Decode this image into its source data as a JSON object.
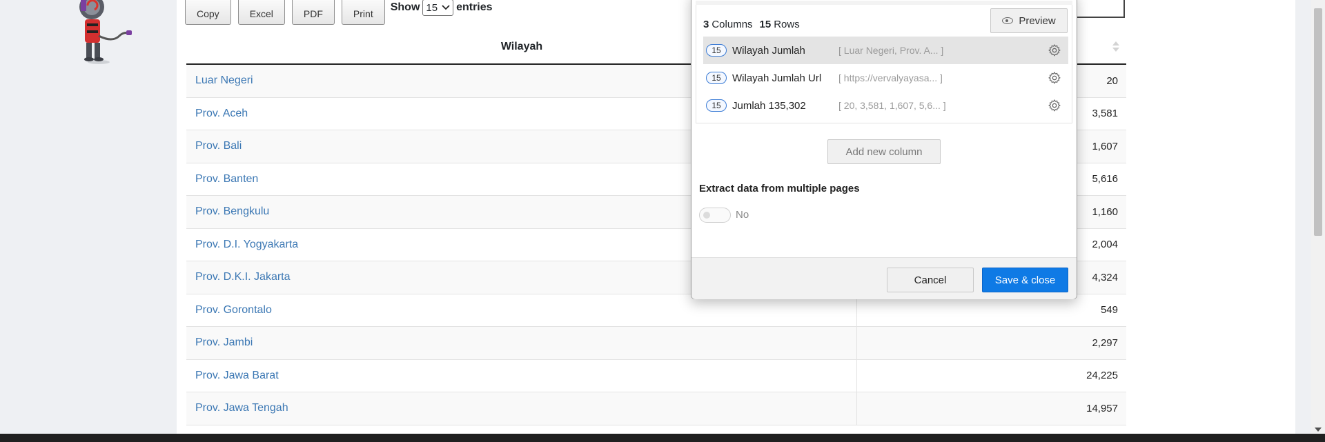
{
  "toolbar": {
    "buttons": [
      "Copy",
      "Excel",
      "PDF",
      "Print"
    ],
    "show_label": "Show",
    "entries_value": "15",
    "entries_label": "entries"
  },
  "table": {
    "header_name": "Wilayah",
    "rows": [
      {
        "name": "Luar Negeri",
        "value": "20"
      },
      {
        "name": "Prov. Aceh",
        "value": "3,581"
      },
      {
        "name": "Prov. Bali",
        "value": "1,607"
      },
      {
        "name": "Prov. Banten",
        "value": "5,616"
      },
      {
        "name": "Prov. Bengkulu",
        "value": "1,160"
      },
      {
        "name": "Prov. D.I. Yogyakarta",
        "value": "2,004"
      },
      {
        "name": "Prov. D.K.I. Jakarta",
        "value": "4,324"
      },
      {
        "name": "Prov. Gorontalo",
        "value": "549"
      },
      {
        "name": "Prov. Jambi",
        "value": "2,297"
      },
      {
        "name": "Prov. Jawa Barat",
        "value": "24,225"
      },
      {
        "name": "Prov. Jawa Tengah",
        "value": "14,957"
      }
    ]
  },
  "dialog": {
    "columns_count": "3",
    "columns_label": "Columns",
    "rows_count": "15",
    "rows_label": "Rows",
    "preview_label": "Preview",
    "columns": [
      {
        "badge": "15",
        "name": "Wilayah Jumlah",
        "preview": "[ Luar Negeri, Prov. A... ]"
      },
      {
        "badge": "15",
        "name": "Wilayah Jumlah Url",
        "preview": "[ https://vervalyayasa... ]"
      },
      {
        "badge": "15",
        "name": "Jumlah 135,302",
        "preview": "[ 20, 3,581, 1,607, 5,6... ]"
      }
    ],
    "add_column_label": "Add new column",
    "extract_label": "Extract data from multiple pages",
    "toggle_label": "No",
    "cancel_label": "Cancel",
    "save_label": "Save & close"
  }
}
